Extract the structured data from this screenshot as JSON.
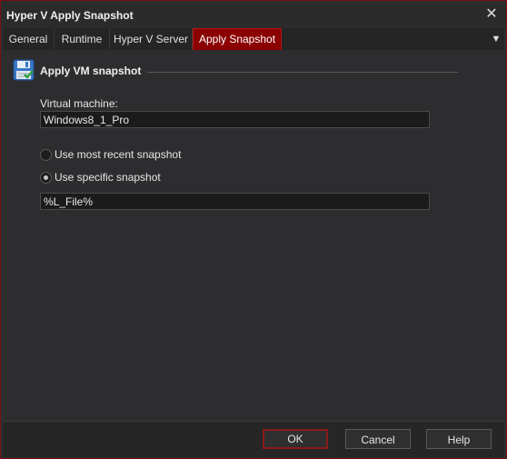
{
  "window": {
    "title": "Hyper V Apply Snapshot",
    "close_glyph": "✕"
  },
  "tabs": [
    {
      "label": "General"
    },
    {
      "label": "Runtime"
    },
    {
      "label": "Hyper V Server"
    },
    {
      "label": "Apply Snapshot",
      "active": true
    }
  ],
  "tab_menu_glyph": "▼",
  "section": {
    "title": "Apply VM snapshot",
    "icon": "save-disk-icon"
  },
  "vm": {
    "label": "Virtual machine:",
    "value": "Windows8_1_Pro"
  },
  "options": [
    {
      "label": "Use most recent snapshot",
      "checked": false
    },
    {
      "label": "Use specific snapshot",
      "checked": true
    }
  ],
  "snapshot": {
    "value": "%L_File%"
  },
  "buttons": {
    "ok": "OK",
    "cancel": "Cancel",
    "help": "Help"
  },
  "colors": {
    "accent": "#8b0000",
    "background": "#2d2d30",
    "input_bg": "#1b1b1c"
  }
}
